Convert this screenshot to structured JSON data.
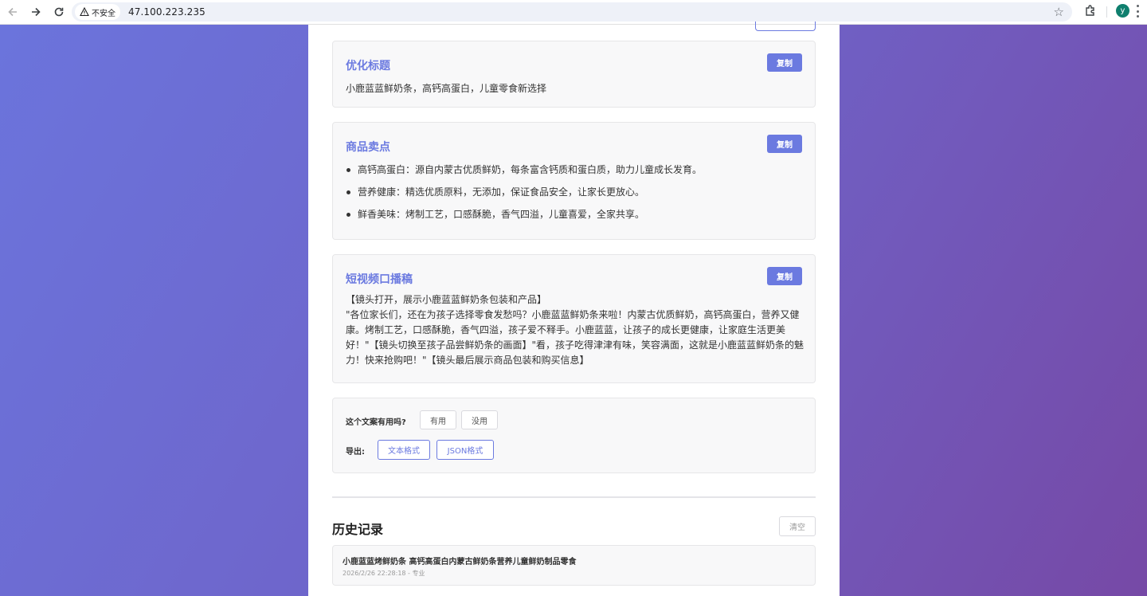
{
  "browser": {
    "security_label": "不安全",
    "url": "47.100.223.235",
    "avatar_letter": "y"
  },
  "cards": {
    "title_card": {
      "heading": "优化标题",
      "copy_label": "复制",
      "text": "小鹿蓝蓝鲜奶条，高钙高蛋白，儿童零食新选择"
    },
    "selling_points": {
      "heading": "商品卖点",
      "copy_label": "复制",
      "items": [
        "高钙高蛋白：源自内蒙古优质鲜奶，每条富含钙质和蛋白质，助力儿童成长发育。",
        "营养健康：精选优质原料，无添加，保证食品安全，让家长更放心。",
        "鲜香美味：烤制工艺，口感酥脆，香气四溢，儿童喜爱，全家共享。"
      ]
    },
    "script": {
      "heading": "短视频口播稿",
      "copy_label": "复制",
      "line1": "【镜头打开，展示小鹿蓝蓝鲜奶条包装和产品】",
      "body": "\"各位家长们，还在为孩子选择零食发愁吗？小鹿蓝蓝鲜奶条来啦！内蒙古优质鲜奶，高钙高蛋白，营养又健康。烤制工艺，口感酥脆，香气四溢，孩子爱不释手。小鹿蓝蓝，让孩子的成长更健康，让家庭生活更美好！\"【镜头切换至孩子品尝鲜奶条的画面】\"看，孩子吃得津津有味，笑容满面，这就是小鹿蓝蓝鲜奶条的魅力！快来抢购吧！\"【镜头最后展示商品包装和购买信息】"
    }
  },
  "feedback": {
    "question": "这个文案有用吗?",
    "useful": "有用",
    "useless": "没用",
    "export_label": "导出:",
    "export_text": "文本格式",
    "export_json": "JSON格式"
  },
  "history": {
    "title": "历史记录",
    "clear_label": "清空",
    "items": [
      {
        "title": "小鹿蓝蓝烤鲜奶条 高钙高蛋白内蒙古鲜奶条营养儿童鲜奶制品零食",
        "meta": "2026/2/26 22:28:18 - 专业"
      }
    ]
  },
  "colors": {
    "accent": "#6b7ae0",
    "bg_gradient_start": "#6b74dc",
    "bg_gradient_end": "#7649a6"
  }
}
